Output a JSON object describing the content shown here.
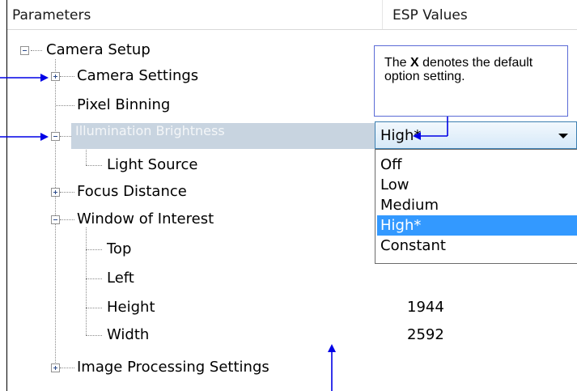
{
  "header": {
    "col_parameters": "Parameters",
    "col_values": "ESP Values"
  },
  "tree": {
    "camera_setup": "Camera Setup",
    "camera_settings": "Camera Settings",
    "pixel_binning": "Pixel Binning",
    "illumination_brightness": "Illumination Brightness",
    "light_source": "Light Source",
    "focus_distance": "Focus Distance",
    "window_of_interest": "Window of Interest",
    "top": "Top",
    "left": "Left",
    "height": "Height",
    "width": "Width",
    "image_processing_settings": "Image Processing Settings"
  },
  "values": {
    "height": "1944",
    "width": "2592"
  },
  "dropdown": {
    "selected": "High*",
    "options": [
      "Off",
      "Low",
      "Medium",
      "High*",
      "Constant"
    ],
    "highlighted_index": 3
  },
  "callout": {
    "text_prefix": "The ",
    "text_bold": "X",
    "text_suffix": " denotes the default option setting."
  },
  "colors": {
    "selected_row_bg": "#c8d4e0",
    "option_highlight": "#3399ff",
    "arrow_color": "#0000e6",
    "callout_border": "#5b6bd6"
  },
  "icons": [
    "tree-expand-icon",
    "tree-collapse-icon",
    "dropdown-arrow-icon",
    "callout-arrow-icon"
  ]
}
